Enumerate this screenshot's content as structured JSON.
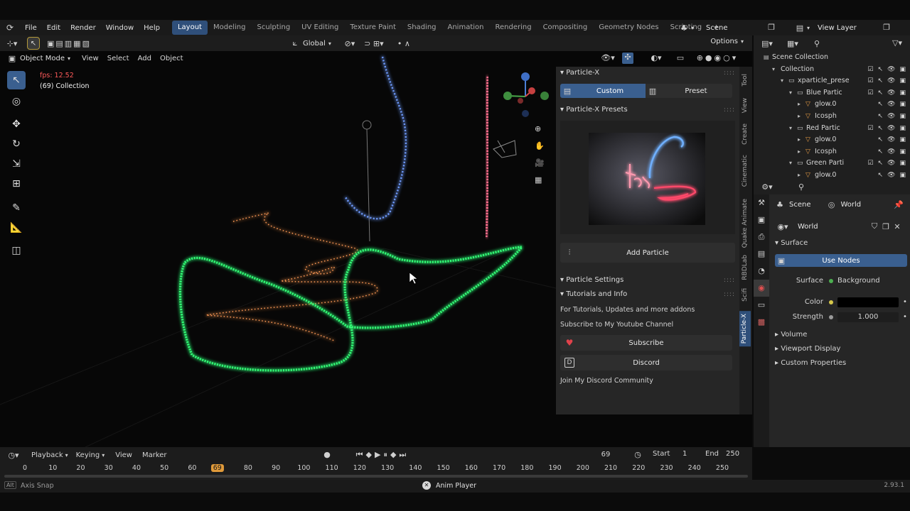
{
  "topbar": {
    "menus": [
      "File",
      "Edit",
      "Render",
      "Window",
      "Help"
    ],
    "workspaces": [
      "Layout",
      "Modeling",
      "Sculpting",
      "UV Editing",
      "Texture Paint",
      "Shading",
      "Animation",
      "Rendering",
      "Compositing",
      "Geometry Nodes",
      "Scripting"
    ],
    "active_workspace": "Layout",
    "add_tab": "+",
    "scene_label": "Scene",
    "view_layer_label": "View Layer"
  },
  "viewport_header": {
    "mode": "Object Mode",
    "menus": [
      "View",
      "Select",
      "Add",
      "Object"
    ],
    "orientation": "Global",
    "options": "Options"
  },
  "viewport": {
    "fps": "fps: 12.52",
    "collection_info": "(69) Collection"
  },
  "particlex": {
    "panel_title": "Particle-X",
    "custom_tab": "Custom",
    "preset_tab": "Preset",
    "presets_title": "Particle-X Presets",
    "add_particle": "Add Particle",
    "settings_title": "Particle Settings",
    "tutorials_title": "Tutorials and Info",
    "tutorials_line": "For Tutorials, Updates and more addons",
    "subscribe_line": "Subscribe to My Youtube Channel",
    "subscribe_btn": "Subscribe",
    "discord_btn": "Discord",
    "discord_line": "Join My Discord Community",
    "side_tabs": [
      "Tool",
      "View",
      "Create",
      "Cinematic",
      "Quake Animate",
      "RBDLab",
      "Scifi",
      "Particle-X"
    ]
  },
  "outliner": {
    "rows": [
      {
        "label": "Scene Collection",
        "indent": 0
      },
      {
        "label": "Collection",
        "indent": 1
      },
      {
        "label": "xparticle_prese",
        "indent": 2
      },
      {
        "label": "Blue Partic",
        "indent": 3
      },
      {
        "label": "glow.0",
        "indent": 4
      },
      {
        "label": "Icosph",
        "indent": 4
      },
      {
        "label": "Red Partic",
        "indent": 3
      },
      {
        "label": "glow.0",
        "indent": 4
      },
      {
        "label": "Icosph",
        "indent": 4
      },
      {
        "label": "Green Parti",
        "indent": 3
      },
      {
        "label": "glow.0",
        "indent": 4
      }
    ]
  },
  "properties": {
    "scene_tab": "Scene",
    "world_tab": "World",
    "world_name": "World",
    "surface_section": "Surface",
    "use_nodes": "Use Nodes",
    "surface_label": "Surface",
    "surface_value": "Background",
    "color_label": "Color",
    "strength_label": "Strength",
    "strength_value": "1.000",
    "collapsed_sections": [
      "Volume",
      "Viewport Display",
      "Custom Properties"
    ]
  },
  "timeline": {
    "menus": [
      "Playback",
      "Keying",
      "View",
      "Marker"
    ],
    "current_frame": "69",
    "start_label": "Start",
    "start_value": "1",
    "end_label": "End",
    "end_value": "250",
    "ticks": [
      "0",
      "10",
      "20",
      "30",
      "40",
      "50",
      "60",
      "69",
      "80",
      "90",
      "100",
      "110",
      "120",
      "130",
      "140",
      "150",
      "160",
      "170",
      "180",
      "190",
      "200",
      "210",
      "220",
      "230",
      "240",
      "250"
    ]
  },
  "statusbar": {
    "left_key": "Alt",
    "left_text": "Axis Snap",
    "center_text": "Anim Player",
    "version": "2.93.1"
  },
  "colors": {
    "accent": "#3a5f8f",
    "active_frame": "#e09a3a",
    "green_particles": "#33ff77",
    "blue_particles": "#6f9cff",
    "red_particles": "#ff6f8f",
    "orange_particles": "#ff9a55"
  }
}
